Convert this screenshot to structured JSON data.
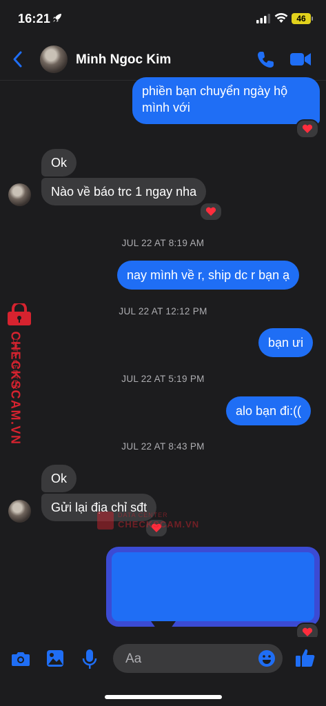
{
  "status_bar": {
    "time": "16:21",
    "battery": "46"
  },
  "header": {
    "contact_name": "Minh Ngoc Kim"
  },
  "messages": {
    "m1": "phiền bạn chuyển ngày hộ",
    "m1b": "mình với",
    "m2": "Ok",
    "m3": "Nào về báo trc 1 ngay nha",
    "ts1": "JUL 22 AT 8:19 AM",
    "m4": "nay mình về r, ship dc r bạn ạ",
    "ts2": "JUL 22 AT 12:12 PM",
    "m5": "bạn ưi",
    "ts3": "JUL 22 AT 5:19 PM",
    "m6": "alo bạn đi:((",
    "ts4": "JUL 22 AT 8:43 PM",
    "m7": "Ok",
    "m8": "Gửi lại địa chỉ sđt"
  },
  "watermark": {
    "brand": "CHECKSCAM.VN",
    "subtitle": "DATA CENTER"
  },
  "composer": {
    "placeholder": "Aa"
  },
  "colors": {
    "accent": "#1f6ef5",
    "incoming": "#3a3a3c",
    "background": "#1c1c1e",
    "watermark": "#d6232f",
    "battery": "#e2d21c"
  },
  "icons": [
    "rocket-icon",
    "signal-icon",
    "wifi-icon",
    "back-chevron-icon",
    "phone-icon",
    "video-icon",
    "heart-icon",
    "camera-icon",
    "photo-icon",
    "mic-icon",
    "emoji-icon",
    "thumbs-up-icon"
  ]
}
